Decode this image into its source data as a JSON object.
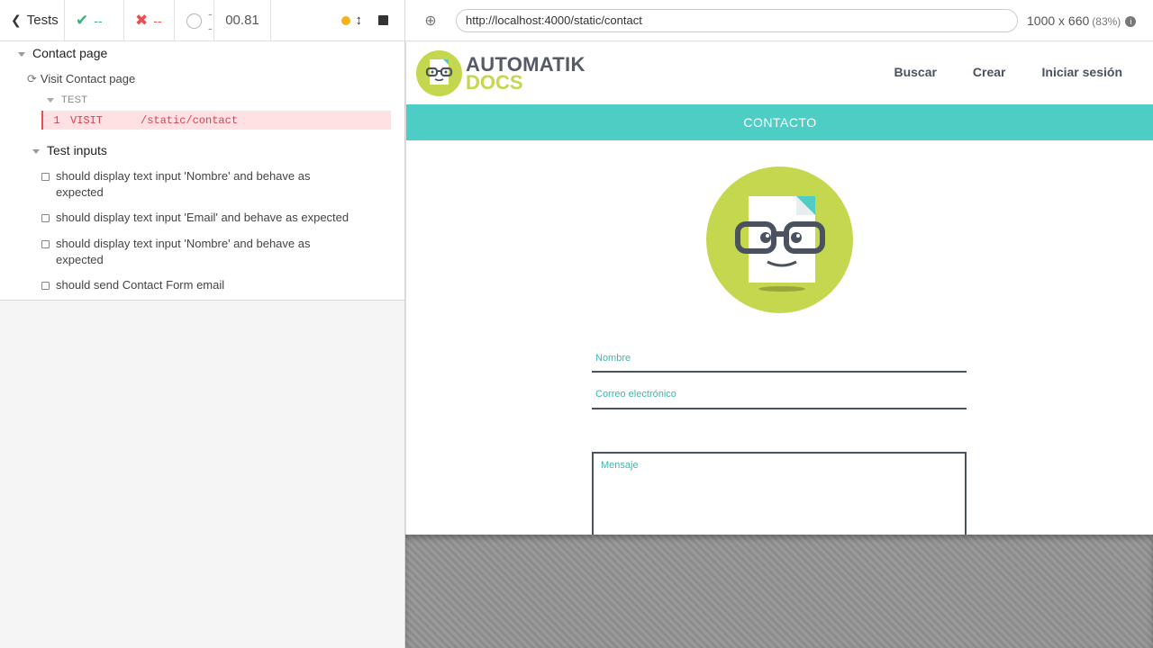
{
  "reporter": {
    "back_label": "Tests",
    "passed": "--",
    "failed": "--",
    "pending": "--",
    "duration": "00.81",
    "suite_title": "Contact page",
    "hook_title": "Visit Contact page",
    "hook_section": "TEST",
    "command": {
      "number": "1",
      "name": "VISIT",
      "message": "/static/contact"
    },
    "inner_suite": "Test inputs",
    "tests": [
      "should display text input 'Nombre' and behave as expected",
      "should display text input 'Email' and behave as expected",
      "should display text input 'Nombre' and behave as expected",
      "should send Contact Form email"
    ]
  },
  "aut": {
    "url": "http://localhost:4000/static/contact",
    "viewport": "1000 x 660",
    "scale": "(83%)"
  },
  "app": {
    "logo_line1": "AUTOMATIK",
    "logo_line2": "DOCS",
    "nav": [
      "Buscar",
      "Crear",
      "Iniciar sesión"
    ],
    "banner": "CONTACTO",
    "fields": {
      "name_label": "Nombre",
      "email_label": "Correo electrónico",
      "message_label": "Mensaje"
    },
    "colors": {
      "brand_green": "#c5d64f",
      "teal": "#4ecdc4",
      "dark": "#4a5260",
      "fail_red": "#e94f4f"
    }
  }
}
